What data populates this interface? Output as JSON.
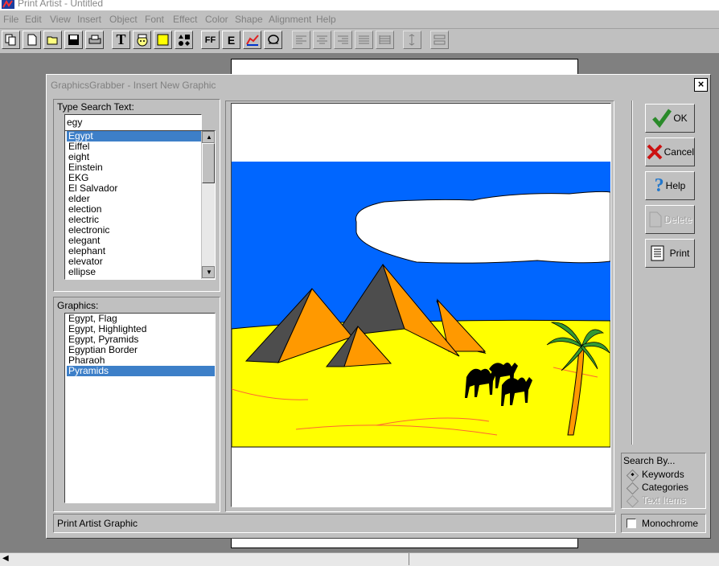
{
  "app": {
    "title": "Print Artist - Untitled"
  },
  "menu": [
    "File",
    "Edit",
    "View",
    "Insert",
    "Object",
    "Font",
    "Effect",
    "Color",
    "Shape",
    "Alignment",
    "Help"
  ],
  "toolbar_icons": [
    "copy-icon",
    "new-icon",
    "open-icon",
    "save-icon",
    "print-icon",
    "text-icon",
    "clipart-face-icon",
    "rectangle-icon",
    "shapes-icon",
    "fonts-icon",
    "edit-text-icon",
    "chart-icon",
    "smart-shape-icon",
    "align-left-icon",
    "align-center-icon",
    "align-right-icon",
    "justify-icon",
    "justify-all-icon",
    "line-spacing-icon",
    "object-spacing-icon"
  ],
  "dialog": {
    "title": "GraphicsGrabber - Insert New Graphic",
    "close": "×",
    "search_label": "Type Search Text:",
    "search_value": "egy",
    "keywords": [
      "Egypt",
      "Eiffel",
      "eight",
      "Einstein",
      "EKG",
      "El Salvador",
      "elder",
      "election",
      "electric",
      "electronic",
      "elegant",
      "elephant",
      "elevator",
      "ellipse"
    ],
    "keywords_selected": 0,
    "graphics_label": "Graphics:",
    "graphics": [
      "Egypt, Flag",
      "Egypt, Highlighted",
      "Egypt, Pyramids",
      "Egyptian Border",
      "Pharaoh",
      "Pyramids"
    ],
    "graphics_selected": 5,
    "status": "Print Artist Graphic",
    "buttons": {
      "ok": "OK",
      "cancel": "Cancel",
      "help": "Help",
      "delete": "Delete",
      "print": "Print"
    },
    "search_by": {
      "label": "Search By...",
      "keywords": "Keywords",
      "categories": "Categories",
      "text_items": "Text Items"
    },
    "monochrome": "Monochrome"
  },
  "colors": {
    "sky": "#0066ff",
    "sand": "#ffff00",
    "pyramid_light": "#ff9900",
    "pyramid_dark": "#4d4d4d",
    "selection": "#3d7fc8",
    "palm_trunk": "#ff9900",
    "palm_leaves": "#339933"
  }
}
